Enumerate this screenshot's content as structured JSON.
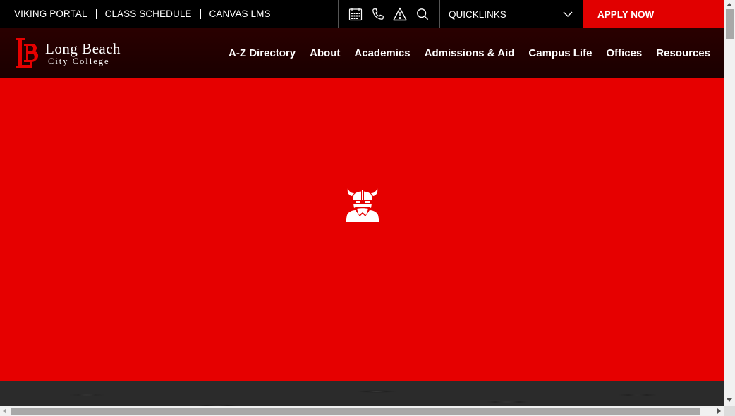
{
  "utility_bar": {
    "links": [
      "VIKING PORTAL",
      "CLASS SCHEDULE",
      "CANVAS LMS"
    ],
    "icons": [
      "calendar-icon",
      "phone-icon",
      "alert-icon",
      "search-icon"
    ],
    "quicklinks_label": "QUICKLINKS",
    "apply_label": "APPLY NOW"
  },
  "header": {
    "logo_line1": "Long Beach",
    "logo_line2": "City College",
    "nav": [
      "A-Z Directory",
      "About",
      "Academics",
      "Admissions & Aid",
      "Campus Life",
      "Offices",
      "Resources"
    ]
  },
  "hero": {
    "loading_icon": "viking-mascot-icon"
  },
  "colors": {
    "brand_red": "#e60000",
    "apply_red": "#e10000",
    "utility_bg": "#000000",
    "header_bg": "#1f0000"
  }
}
